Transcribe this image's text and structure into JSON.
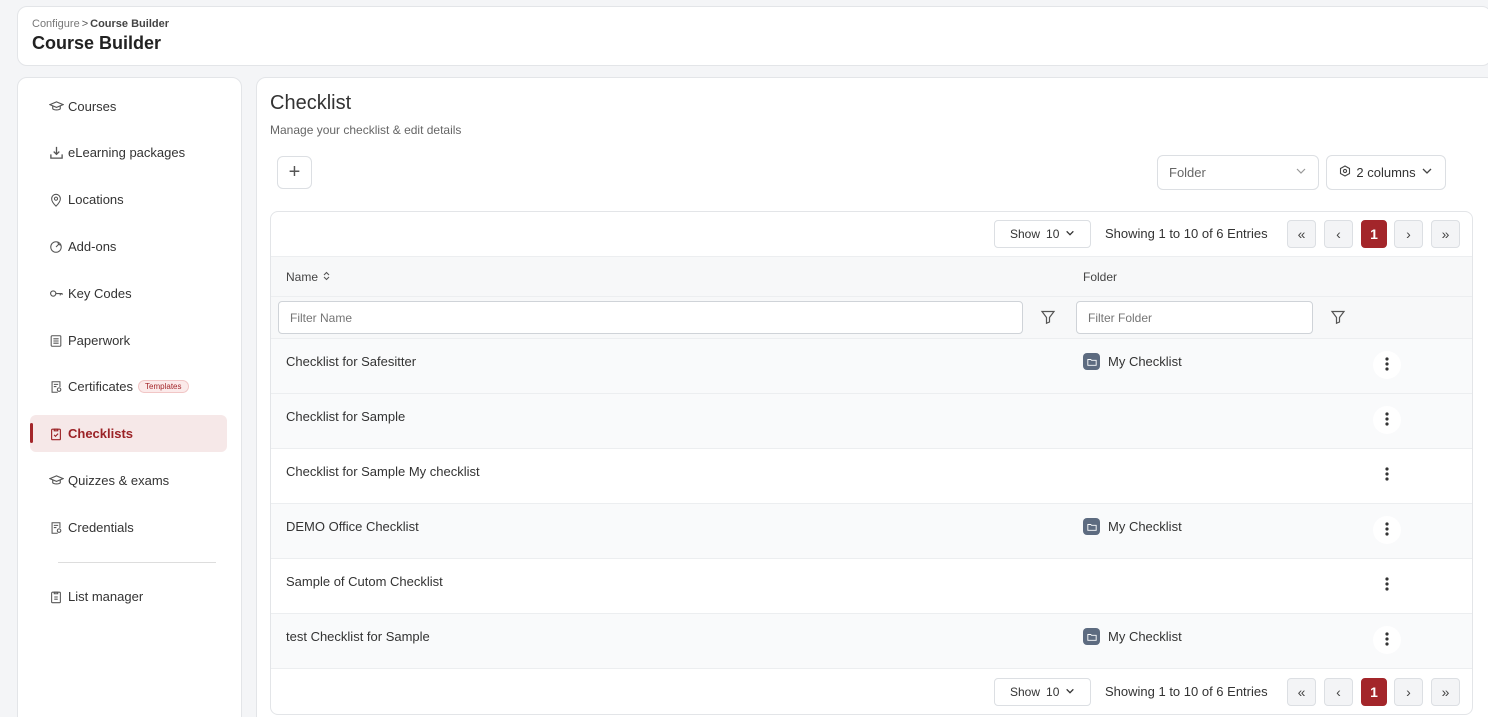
{
  "header": {
    "breadcrumb_parent": "Configure",
    "breadcrumb_separator": ">",
    "breadcrumb_current": "Course Builder",
    "title": "Course Builder"
  },
  "sidebar": {
    "items": [
      {
        "label": "Courses",
        "icon": "graduation-cap-icon"
      },
      {
        "label": "eLearning packages",
        "icon": "download-icon"
      },
      {
        "label": "Locations",
        "icon": "map-pin-icon"
      },
      {
        "label": "Add-ons",
        "icon": "addon-icon"
      },
      {
        "label": "Key Codes",
        "icon": "key-icon"
      },
      {
        "label": "Paperwork",
        "icon": "document-list-icon"
      },
      {
        "label": "Certificates",
        "icon": "certificate-icon",
        "badge": "Templates"
      },
      {
        "label": "Checklists",
        "icon": "clipboard-check-icon",
        "active": true
      },
      {
        "label": "Quizzes & exams",
        "icon": "graduation-cap-icon"
      },
      {
        "label": "Credentials",
        "icon": "certificate-icon"
      },
      {
        "label": "List manager",
        "icon": "clipboard-list-icon"
      }
    ]
  },
  "main": {
    "title": "Checklist",
    "subtitle": "Manage your checklist & edit details",
    "add_symbol": "+",
    "folder_select": {
      "value": "Folder"
    },
    "columns_button": {
      "label": "2 columns"
    },
    "pager": {
      "show_label": "Show",
      "page_size": "10",
      "entries_text": "Showing 1 to 10 of 6 Entries",
      "first": "«",
      "prev": "‹",
      "current_page": "1",
      "next": "›",
      "last": "»"
    },
    "table": {
      "columns": [
        "Name",
        "Folder"
      ],
      "filter_name_placeholder": "Filter Name",
      "filter_folder_placeholder": "Filter Folder",
      "rows": [
        {
          "name": "Checklist for Safesitter",
          "folder": "My Checklist"
        },
        {
          "name": "Checklist for Sample",
          "folder": ""
        },
        {
          "name": "Checklist for Sample My checklist",
          "folder": ""
        },
        {
          "name": "DEMO Office Checklist",
          "folder": "My Checklist"
        },
        {
          "name": "Sample of Cutom Checklist",
          "folder": ""
        },
        {
          "name": "test Checklist for Sample",
          "folder": "My Checklist"
        }
      ]
    }
  },
  "colors": {
    "accent": "#a3262a",
    "active_bg": "#f6e8e8",
    "folder_chip": "#5d6b80"
  }
}
